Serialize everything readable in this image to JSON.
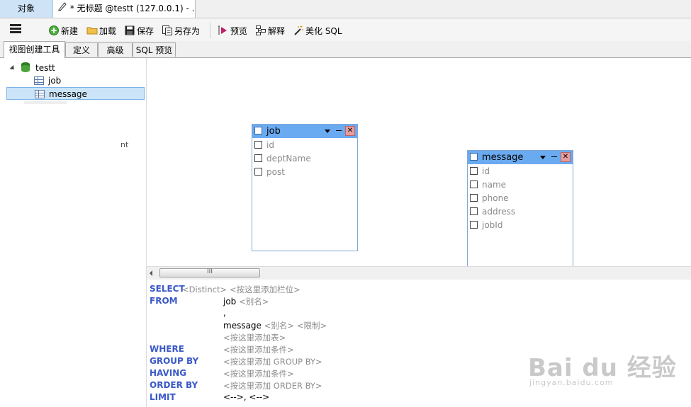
{
  "tabs": {
    "objects_label": "对象",
    "document_label": "* 无标题 @testt (127.0.0.1) - ..."
  },
  "toolbar": {
    "new_label": "新建",
    "load_label": "加载",
    "save_label": "保存",
    "save_as_label": "另存为",
    "preview_label": "预览",
    "explain_label": "解释",
    "beautify_label": "美化 SQL"
  },
  "subtabs": {
    "builder_label": "视图创建工具",
    "definition_label": "定义",
    "advanced_label": "高级",
    "sql_preview_label": "SQL 预览"
  },
  "tree": {
    "database": "testt",
    "tables": [
      "job",
      "message"
    ],
    "selected": "message",
    "ghost_text": "nt"
  },
  "canvas": {
    "entities": [
      {
        "name": "job",
        "fields": [
          "id",
          "deptName",
          "post"
        ]
      },
      {
        "name": "message",
        "fields": [
          "id",
          "name",
          "phone",
          "address",
          "jobId"
        ]
      }
    ]
  },
  "scrollbar": {
    "thumb_grip": "III"
  },
  "sql": {
    "select_kw": "SELECT",
    "distinct_hint": "<Distinct>",
    "add_column_hint": "<按这里添加栏位>",
    "from_kw": "FROM",
    "from_table1": "job",
    "alias_hint": "<别名>",
    "comma": ",",
    "from_table2": "message",
    "limit_hint": "<限制>",
    "add_table_hint": "<按这里添加表>",
    "where_kw": "WHERE",
    "add_condition_hint": "<按这里添加条件>",
    "groupby_kw": "GROUP BY",
    "add_groupby_hint": "<按这里添加 GROUP BY>",
    "having_kw": "HAVING",
    "add_having_hint": "<按这里添加条件>",
    "orderby_kw": "ORDER BY",
    "add_orderby_hint": "<按这里添加 ORDER BY>",
    "limit_kw": "LIMIT",
    "limit_value": "<-->, <-->"
  },
  "watermark": {
    "brand": "Bai du 经验",
    "url": "jingyan.baidu.com"
  }
}
